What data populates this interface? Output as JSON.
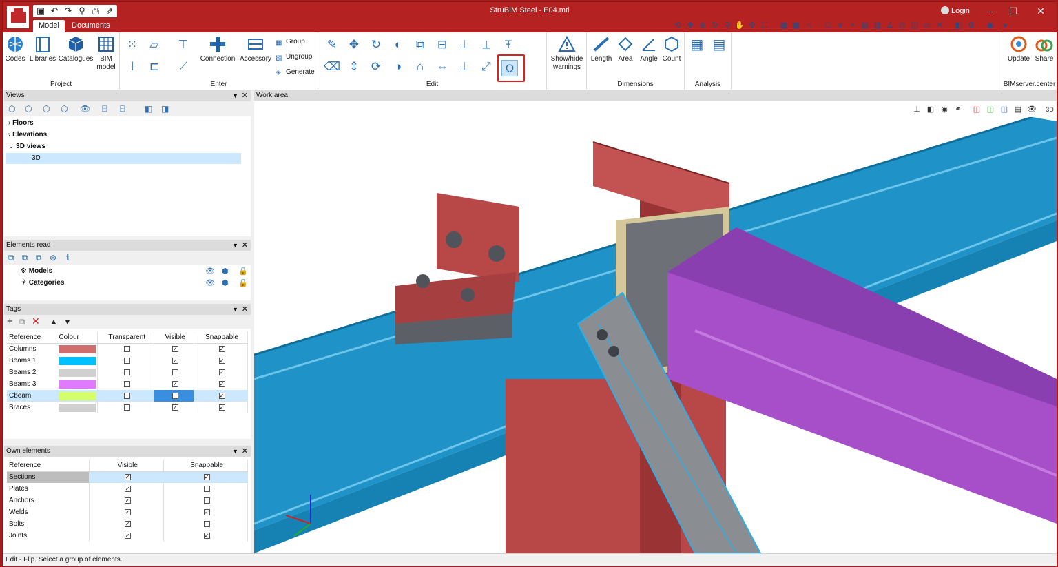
{
  "titlebar": {
    "title": "StruBIM Steel - E04.mtl",
    "login_label": "Login",
    "quick_access": [
      "save-icon",
      "undo-icon",
      "redo-icon",
      "search-icon",
      "print-icon",
      "export-icon"
    ]
  },
  "tabs": [
    "Model",
    "Documents"
  ],
  "ribbon": {
    "project": {
      "label": "Project",
      "buttons": [
        "Codes",
        "Libraries",
        "Catalogues",
        "BIM model"
      ]
    },
    "enter": {
      "label": "Enter",
      "buttons": [
        "Connection",
        "Accessory"
      ],
      "small": [
        "Group",
        "Ungroup",
        "Generate"
      ]
    },
    "edit": {
      "label": "Edit"
    },
    "warnings": {
      "button": "Show/hide warnings"
    },
    "dimensions": {
      "label": "Dimensions",
      "buttons": [
        "Length",
        "Area",
        "Angle",
        "Count"
      ]
    },
    "analysis": {
      "label": "Analysis"
    },
    "bimserver": {
      "label": "BIMserver.center",
      "buttons": [
        "Update",
        "Share"
      ]
    }
  },
  "views": {
    "title": "Views",
    "tree": [
      "Floors",
      "Elevations",
      "3D views",
      "3D"
    ]
  },
  "elements_read": {
    "title": "Elements read",
    "items": [
      "Models",
      "Categories"
    ]
  },
  "tags": {
    "title": "Tags",
    "headers": [
      "Reference",
      "Colour",
      "Transparent",
      "Visible",
      "Snappable"
    ],
    "rows": [
      {
        "ref": "Columns",
        "colour": "#d06e6e",
        "transparent": false,
        "visible": true,
        "snappable": true
      },
      {
        "ref": "Beams 1",
        "colour": "#00c0ff",
        "transparent": false,
        "visible": true,
        "snappable": true
      },
      {
        "ref": "Beams 2",
        "colour": "#d0d0d0",
        "transparent": false,
        "visible": false,
        "snappable": true
      },
      {
        "ref": "Beams 3",
        "colour": "#e07aff",
        "transparent": false,
        "visible": true,
        "snappable": true
      },
      {
        "ref": "Cbeam",
        "colour": "#d4ff6a",
        "transparent": false,
        "visible": false,
        "snappable": true
      },
      {
        "ref": "Braces",
        "colour": "#d0d0d0",
        "transparent": false,
        "visible": true,
        "snappable": true
      }
    ]
  },
  "own_elements": {
    "title": "Own elements",
    "headers": [
      "Reference",
      "Visible",
      "Snappable"
    ],
    "rows": [
      {
        "ref": "Sections",
        "visible": true,
        "snappable": true
      },
      {
        "ref": "Plates",
        "visible": true,
        "snappable": false
      },
      {
        "ref": "Anchors",
        "visible": true,
        "snappable": false
      },
      {
        "ref": "Welds",
        "visible": true,
        "snappable": true
      },
      {
        "ref": "Bolts",
        "visible": true,
        "snappable": false
      },
      {
        "ref": "Joints",
        "visible": true,
        "snappable": true
      }
    ]
  },
  "work_area": {
    "title": "Work area"
  },
  "status": "Edit - Flip. Select a group of elements.",
  "colors": {
    "accent": "#b42222",
    "beam_blue": "#1a8fc2",
    "beam_purple": "#a64fc8",
    "column_red": "#b84848",
    "plate": "#b84848",
    "steel_grey": "#8a8d91"
  }
}
